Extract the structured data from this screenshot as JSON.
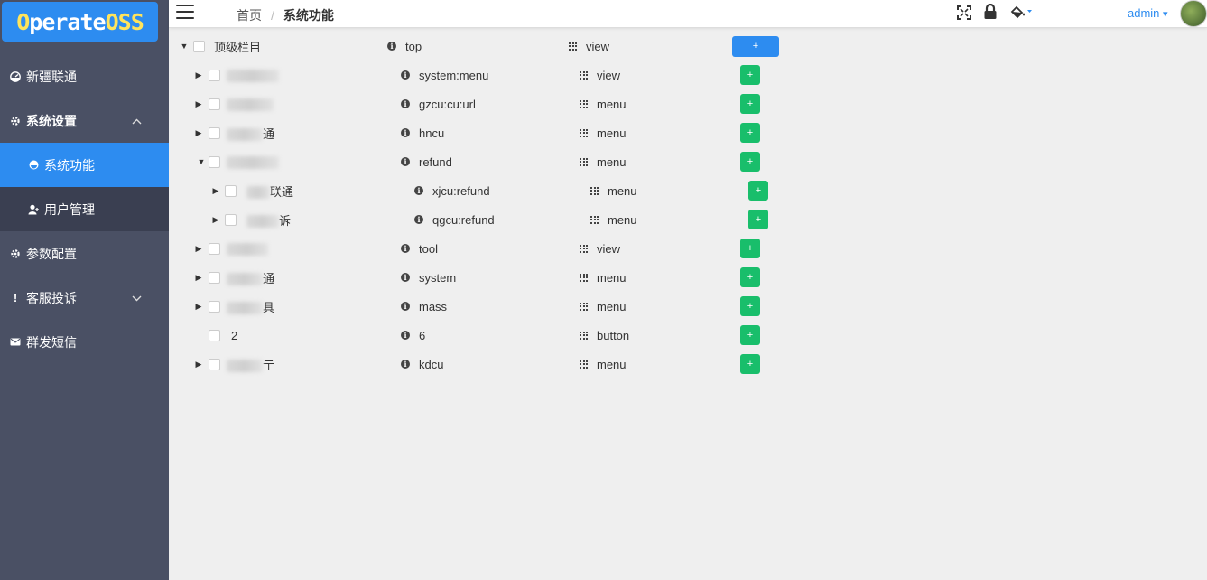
{
  "logo": {
    "part1": "O",
    "part2": "perate ",
    "part3": "OSS"
  },
  "sidebar": {
    "items": [
      {
        "label": "新疆联通",
        "icon": "dashboard-icon"
      },
      {
        "label": "系统设置",
        "icon": "gear-icon",
        "expanded": true
      },
      {
        "label": "系统功能",
        "icon": "circle-icon",
        "selected": true
      },
      {
        "label": "用户管理",
        "icon": "user-icon"
      },
      {
        "label": "参数配置",
        "icon": "gear-icon"
      },
      {
        "label": "客服投诉",
        "icon": "exclamation-icon"
      },
      {
        "label": "群发短信",
        "icon": "envelope-icon"
      }
    ]
  },
  "header": {
    "breadcrumb_home": "首页",
    "breadcrumb_sep": "/",
    "breadcrumb_current": "系统功能",
    "user": "admin",
    "user_caret": "▾"
  },
  "tree": {
    "rows": [
      {
        "name": "顶级栏目",
        "code": "top",
        "type": "view",
        "btn": "+"
      },
      {
        "name": "",
        "code": "system:menu",
        "type": "view",
        "btn": "+"
      },
      {
        "name": "",
        "code": "gzcu:cu:url",
        "type": "menu",
        "btn": "+"
      },
      {
        "name": "通",
        "code": "hncu",
        "type": "menu",
        "btn": "+"
      },
      {
        "name": "",
        "code": "refund",
        "type": "menu",
        "btn": "+"
      },
      {
        "name": "联通",
        "code": "xjcu:refund",
        "type": "menu",
        "btn": "+"
      },
      {
        "name": "诉",
        "code": "qgcu:refund",
        "type": "menu",
        "btn": "+"
      },
      {
        "name": "",
        "code": "tool",
        "type": "view",
        "btn": "+"
      },
      {
        "name": "通",
        "code": "system",
        "type": "menu",
        "btn": "+"
      },
      {
        "name": "具",
        "code": "mass",
        "type": "menu",
        "btn": "+"
      },
      {
        "name": "2",
        "code": "6",
        "type": "button",
        "btn": "+"
      },
      {
        "name": "亍",
        "code": "kdcu",
        "type": "menu",
        "btn": "+"
      }
    ]
  }
}
